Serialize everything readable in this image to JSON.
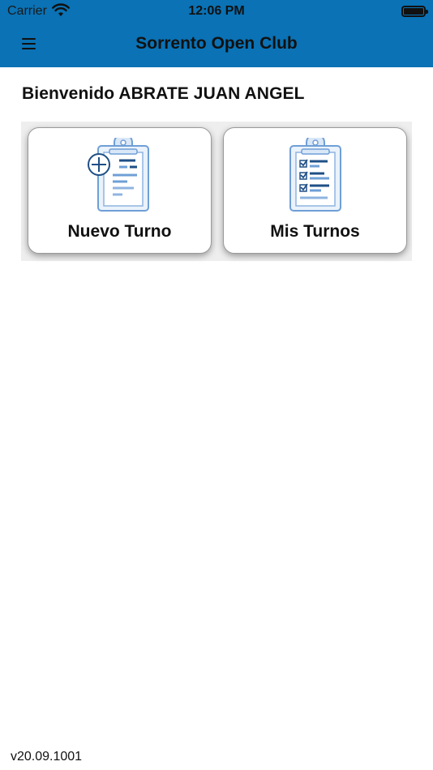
{
  "status_bar": {
    "carrier": "Carrier",
    "time": "12:06 PM"
  },
  "header": {
    "title": "Sorrento Open Club"
  },
  "welcome": {
    "text": "Bienvenido ABRATE JUAN ANGEL"
  },
  "tiles": [
    {
      "label": "Nuevo Turno",
      "icon": "clipboard-add-icon"
    },
    {
      "label": "Mis Turnos",
      "icon": "clipboard-checklist-icon"
    }
  ],
  "footer": {
    "version": "v20.09.1001"
  },
  "colors": {
    "header_bg": "#0a72b5",
    "icon_blue": "#6f9fd6",
    "icon_dark": "#1f4f86"
  }
}
